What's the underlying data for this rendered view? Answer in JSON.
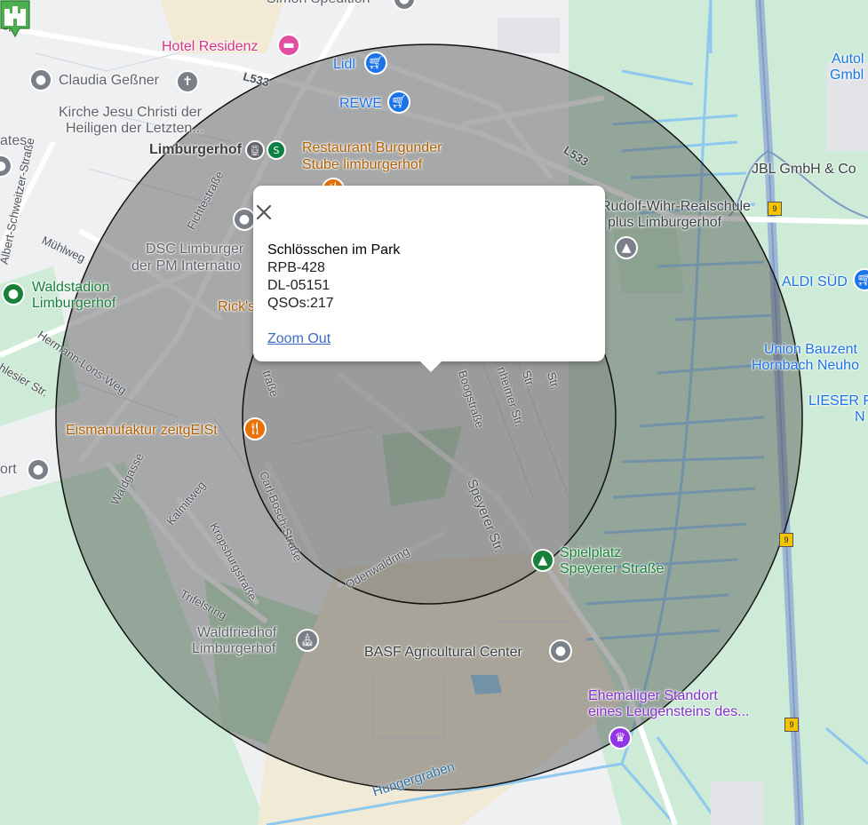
{
  "popup": {
    "name": "Schlösschen im Park",
    "ref": "RPB-428",
    "dok": "DL-05151",
    "qsos": "QSOs:217",
    "zoom_out": "Zoom Out"
  },
  "icons": {
    "close": "close-icon",
    "marker": "castle-marker-icon"
  },
  "colors": {
    "park": "#c8e6c9",
    "water": "#8ec8ef",
    "circle_fill": "rgba(80,80,80,0.45)",
    "circle_stroke": "#111111",
    "marker": "#4caf50"
  },
  "places": {
    "hotel": "Hotel Residenz",
    "lidl": "Lidl",
    "rewe": "REWE",
    "gessner": "Claudia Geßner",
    "church1": "Kirche Jesu Christi der",
    "church2": "Heiligen der Letzten...",
    "station": "Limburgerhof",
    "restaurant1": "Restaurant Burgunder",
    "restaurant2": "Stube limburgerhof",
    "dsc1": "DSC Limburger",
    "dsc2": "der PM Internatio",
    "stadium1": "Waldstadion",
    "stadium2": "Limburgerhof",
    "ricks": "Rick's",
    "eis": "Eismanufaktur zeitgEISt",
    "ort": "ort",
    "ates": "ates",
    "school1": "Rudolf-Wihr-Realschule",
    "school2": "plus Limburgerhof",
    "jbl": "JBL GmbH & Co",
    "auto1": "Autol",
    "auto2": "Gmbl",
    "aldi": "ALDI SÜD",
    "union1": "Union Bauzent",
    "union2": "Hornbach Neuho",
    "lieser1": "LIESER F",
    "lieser2": "N",
    "spiel1": "Spielplatz",
    "spiel2": "Speyerer Straße",
    "friedhof1": "Waldfriedhof",
    "friedhof2": "Limburgerhof",
    "basf": "BASF Agricultural Center",
    "stein1": "Ehemaliger Standort",
    "stein2": "eines Leugensteins des...",
    "simon": "Simon Spedition"
  },
  "roads": {
    "l533a": "L533",
    "l533b": "L533",
    "str": "Str.",
    "albert": "Albert-Schweitzer-Straße",
    "muehlweg": "Mühlweg",
    "fichte": "Fichtestraße",
    "hermann": "Hermann-Löns-Weg",
    "schlesier": "hlesier Str.",
    "waldgasse": "Waldgasse",
    "kalmit": "Kalmitweg",
    "kropsburg": "Kropsburgstraße",
    "trifels": "Trifelsring",
    "carlbosch": "Carl-Bosch-Straße",
    "odenwald": "Odenwaldring",
    "speyerer": "Speyerer Str.",
    "boog": "Boogstraße",
    "heimer": "nheimer Str.",
    "str2": "Str.",
    "str3": "Str.",
    "strasse": "traße",
    "hunger": "Hungergraben",
    "b9a": "9",
    "b9b": "9",
    "b9c": "9"
  }
}
